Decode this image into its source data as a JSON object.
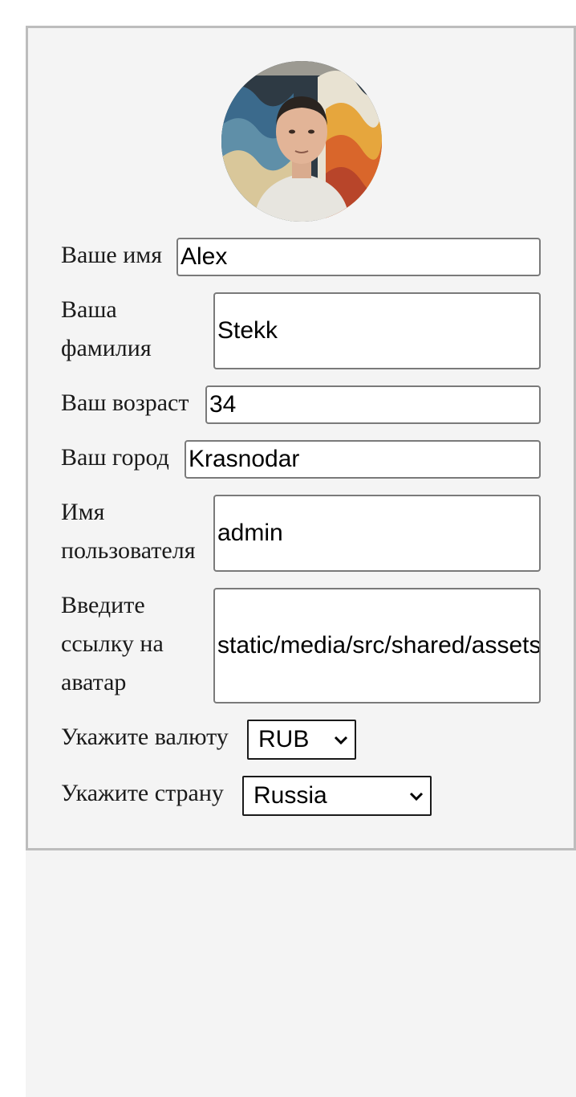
{
  "profile": {
    "avatar_alt": "Profile photo",
    "fields": {
      "first_name": {
        "label": "Ваше имя",
        "value": "Alex"
      },
      "last_name": {
        "label_line1": "Ваша",
        "label_line2": "фамилия",
        "value": "Stekk"
      },
      "age": {
        "label": "Ваш возраст",
        "value": "34"
      },
      "city": {
        "label": "Ваш город",
        "value": "Krasnodar"
      },
      "username": {
        "label_line1": "Имя",
        "label_line2": "пользователя",
        "value": "admin"
      },
      "avatar_url": {
        "label_line1": "Введите",
        "label_line2": "ссылку на",
        "label_line3": "аватар",
        "value": "static/media/src/shared/assets/avatar.jpg"
      },
      "currency": {
        "label": "Укажите валюту",
        "value": "RUB"
      },
      "country": {
        "label": "Укажите страну",
        "value": "Russia"
      }
    }
  },
  "colors": {
    "card_border": "#bdbdbd",
    "background": "#f4f4f4",
    "input_border": "#7a7a7a"
  }
}
